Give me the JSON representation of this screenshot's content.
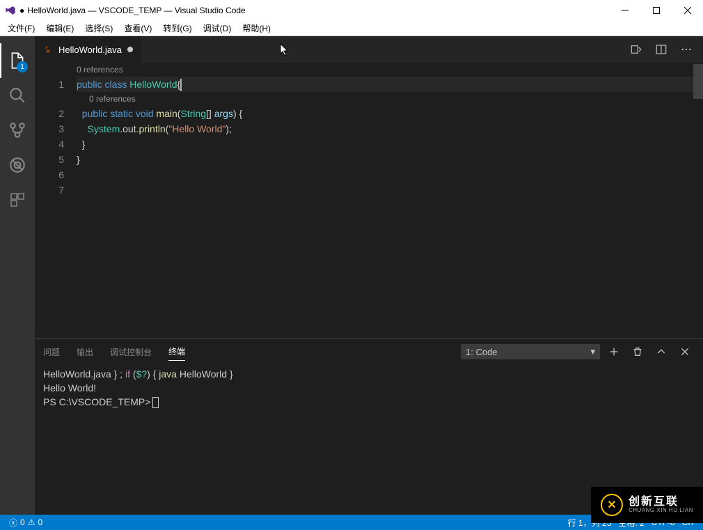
{
  "titlebar": {
    "dot": "●",
    "title": "HelloWorld.java — VSCODE_TEMP — Visual Studio Code"
  },
  "menubar": [
    "文件(F)",
    "编辑(E)",
    "选择(S)",
    "查看(V)",
    "转到(G)",
    "调试(D)",
    "帮助(H)"
  ],
  "activitybar": {
    "badge": "1"
  },
  "tab": {
    "name": "HelloWorld.java"
  },
  "codelens": {
    "refs0": "0 references",
    "refs1": "0 references"
  },
  "code": {
    "l1_public": "public",
    "l1_class": "class",
    "l1_name": "HelloWorld",
    "l1_brace": "{",
    "l2_public": "public",
    "l2_static": "static",
    "l2_void": "void",
    "l2_main": "main",
    "l2_paren_o": "(",
    "l2_type": "String",
    "l2_arr": "[]",
    "l2_args": "args",
    "l2_paren_c": ")",
    "l2_brace": "{",
    "l3_sys": "System",
    "l3_out": ".out.",
    "l3_println": "println",
    "l3_po": "(",
    "l3_str": "\"Hello World\"",
    "l3_pc": ");",
    "l4_brace": "}",
    "l5_brace": "}"
  },
  "linenums": [
    "1",
    "2",
    "3",
    "4",
    "5",
    "6",
    "7"
  ],
  "panel": {
    "tabs": [
      "问题",
      "输出",
      "调试控制台",
      "终端"
    ],
    "select": "1: Code",
    "arrowdown": "▾"
  },
  "terminal": {
    "line1_pre": " HelloWorld.java } ; ",
    "line1_if": "if",
    "line1_mid": " (",
    "line1_var": "$?",
    "line1_mid2": ") { ",
    "line1_java": "java",
    "line1_post": " HelloWorld }",
    "line2": "Hello World!",
    "line3": "PS C:\\VSCODE_TEMP>"
  },
  "statusbar": {
    "errors_icon": "ⓧ",
    "errors": "0",
    "warnings_icon": "⚠",
    "warnings": "0",
    "lncol": "行 1，列 25",
    "spaces": "空格: 2",
    "encoding": "UTF-8",
    "eol": "CR"
  },
  "watermark": {
    "cn": "创新互联",
    "en": "CHUANG XIN HU LIAN"
  }
}
